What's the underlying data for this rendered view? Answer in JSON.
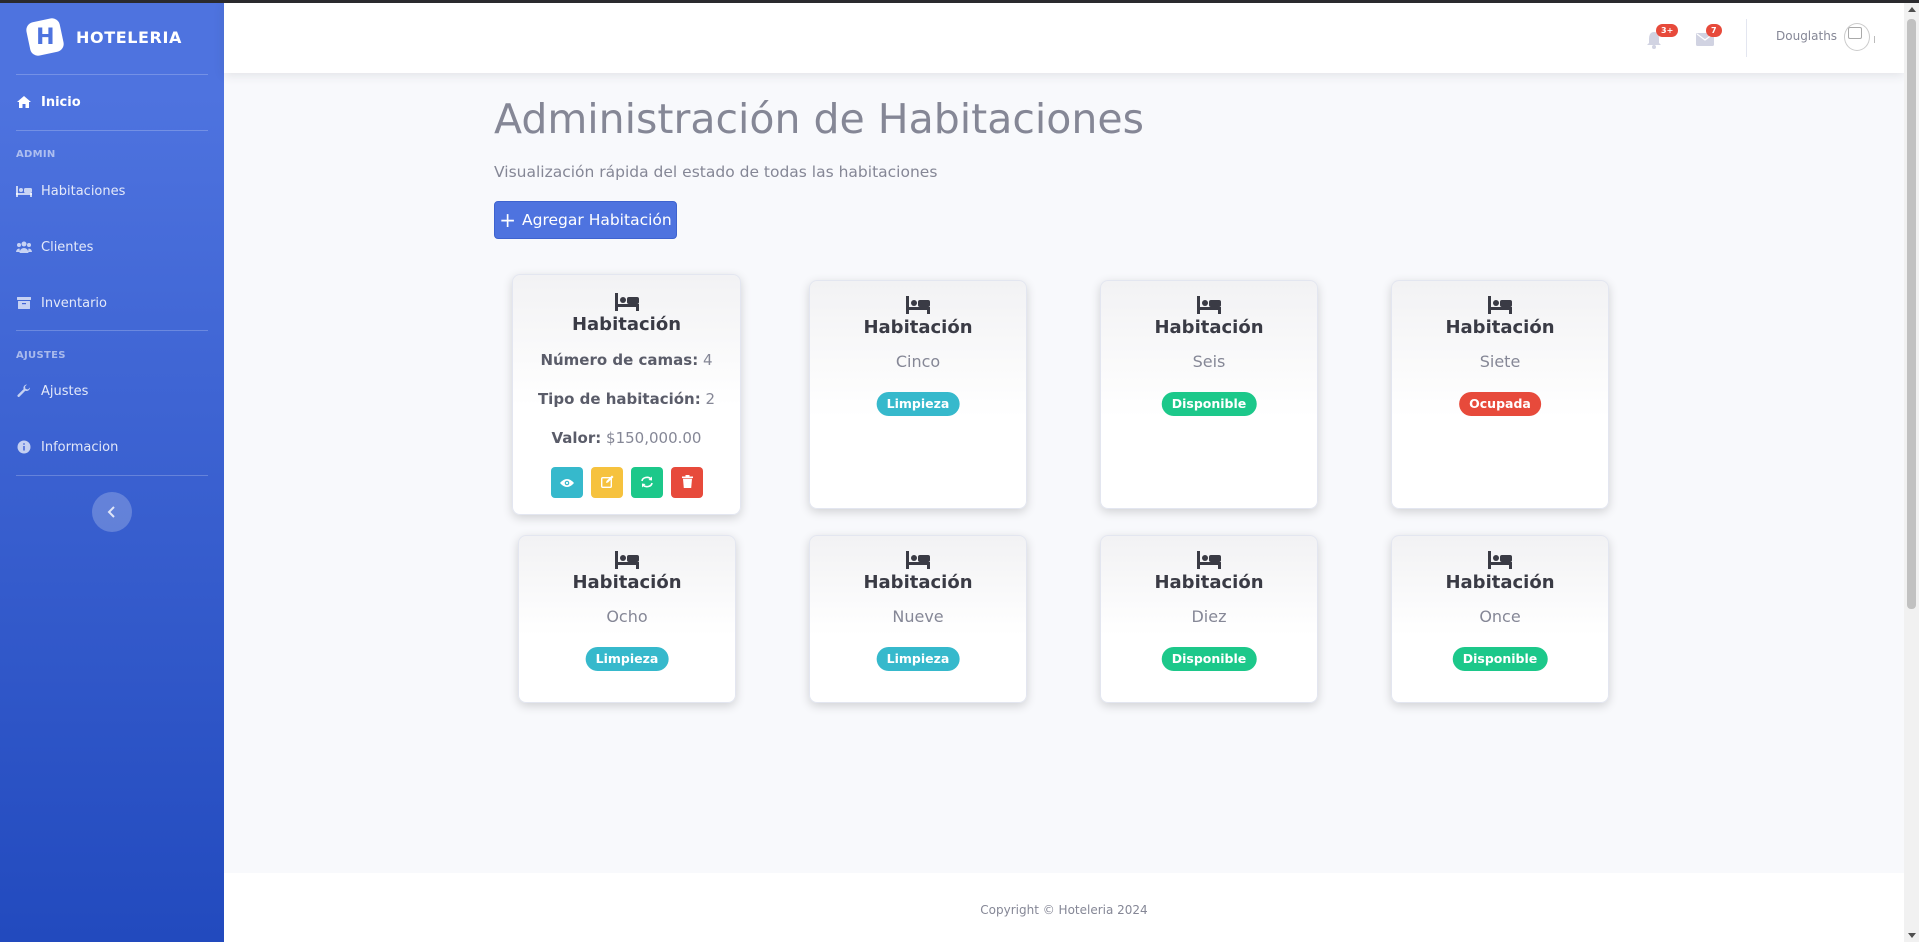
{
  "app": {
    "brand_name": "HOTELERIA",
    "brand_letter": "H"
  },
  "sidebar": {
    "home": {
      "label": "Inicio",
      "icon": "home-icon"
    },
    "sections": [
      {
        "heading": "ADMIN",
        "items": [
          {
            "label": "Habitaciones",
            "icon": "bed-icon"
          },
          {
            "label": "Clientes",
            "icon": "users-icon"
          },
          {
            "label": "Inventario",
            "icon": "archive-icon"
          }
        ]
      },
      {
        "heading": "AJUSTES",
        "items": [
          {
            "label": "Ajustes",
            "icon": "wrench-icon"
          },
          {
            "label": "Informacion",
            "icon": "info-icon"
          }
        ]
      }
    ],
    "toggle_icon": "chevron-left-icon"
  },
  "topbar": {
    "alerts_count": "3+",
    "messages_count": "7",
    "user_name": "Douglaths"
  },
  "page": {
    "title": "Administración de Habitaciones",
    "subtitle": "Visualización rápida del estado de todas las habitaciones",
    "add_button": "Agregar Habitación",
    "add_button_icon": "+"
  },
  "rooms": [
    {
      "title": "Habitación",
      "expanded": true,
      "details": [
        {
          "label": "Número de camas:",
          "value": "4"
        },
        {
          "label": "Tipo de habitación:",
          "value": "2"
        },
        {
          "label": "Valor:",
          "value": "$150,000.00"
        }
      ],
      "actions": [
        "view-icon",
        "edit-icon",
        "refresh-icon",
        "trash-icon"
      ]
    },
    {
      "title": "Habitación",
      "name": "Cinco",
      "status": "Limpieza",
      "status_color": "#36b9cc"
    },
    {
      "title": "Habitación",
      "name": "Seis",
      "status": "Disponible",
      "status_color": "#1cc88a"
    },
    {
      "title": "Habitación",
      "name": "Siete",
      "status": "Ocupada",
      "status_color": "#e74a3b"
    },
    {
      "title": "Habitación",
      "name": "Ocho",
      "status": "Limpieza",
      "status_color": "#36b9cc"
    },
    {
      "title": "Habitación",
      "name": "Nueve",
      "status": "Limpieza",
      "status_color": "#36b9cc"
    },
    {
      "title": "Habitación",
      "name": "Diez",
      "status": "Disponible",
      "status_color": "#1cc88a"
    },
    {
      "title": "Habitación",
      "name": "Once",
      "status": "Disponible",
      "status_color": "#1cc88a"
    }
  ],
  "footer": {
    "copyright": "Copyright © Hoteleria 2024"
  },
  "colors": {
    "primary": "#4e73df",
    "info": "#36b9cc",
    "success": "#1cc88a",
    "warning": "#f6c23e",
    "danger": "#e74a3b"
  }
}
